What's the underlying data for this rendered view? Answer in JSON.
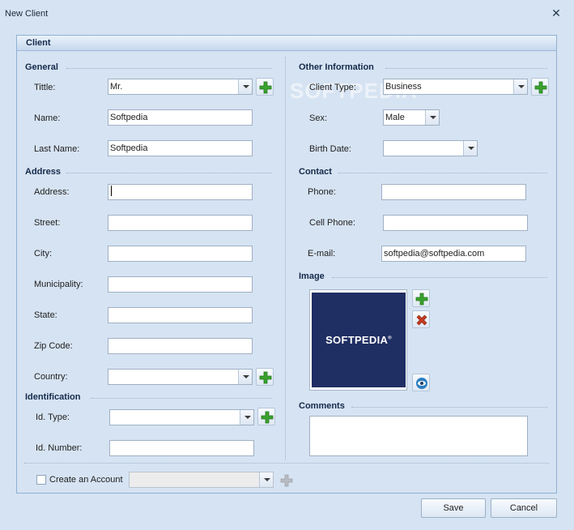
{
  "window": {
    "title": "New Client",
    "close_glyph": "✕"
  },
  "group_title": "Client",
  "watermark": "SOFTPEDIA",
  "general": {
    "title": "General",
    "title_label": "Tittle:",
    "title_value": "Mr.",
    "name_label": "Name:",
    "name_value": "Softpedia",
    "last_name_label": "Last Name:",
    "last_name_value": "Softpedia"
  },
  "address": {
    "title": "Address",
    "address_label": "Address:",
    "address_value": "",
    "street_label": "Street:",
    "street_value": "",
    "city_label": "City:",
    "city_value": "",
    "municipality_label": "Municipality:",
    "municipality_value": "",
    "state_label": "State:",
    "state_value": "",
    "zip_label": "Zip Code:",
    "zip_value": "",
    "country_label": "Country:",
    "country_value": ""
  },
  "identification": {
    "title": "Identification",
    "type_label": "Id. Type:",
    "type_value": "",
    "number_label": "Id. Number:",
    "number_value": ""
  },
  "other": {
    "title": "Other Information",
    "client_type_label": "Client Type:",
    "client_type_value": "Business",
    "sex_label": "Sex:",
    "sex_value": "Male",
    "birth_label": "Birth Date:",
    "birth_value": ""
  },
  "contact": {
    "title": "Contact",
    "phone_label": "Phone:",
    "phone_value": "",
    "cell_label": "Cell Phone:",
    "cell_value": "",
    "email_label": "E-mail:",
    "email_value": "softpedia@softpedia.com"
  },
  "image": {
    "title": "Image",
    "logo_text": "SOFTPEDIA",
    "logo_mark": "®",
    "icons": [
      "plus-icon",
      "delete-x-icon",
      "eye-view-icon"
    ]
  },
  "comments": {
    "title": "Comments",
    "value": ""
  },
  "account": {
    "checkbox_label": "Create an Account",
    "combo_value": "",
    "checked": false
  },
  "buttons": {
    "save": "Save",
    "cancel": "Cancel"
  },
  "colors": {
    "background": "#d6e3f2",
    "plus_green": "#3aa12f",
    "delete_red": "#c23b22",
    "image_bg": "#1f2e63"
  }
}
